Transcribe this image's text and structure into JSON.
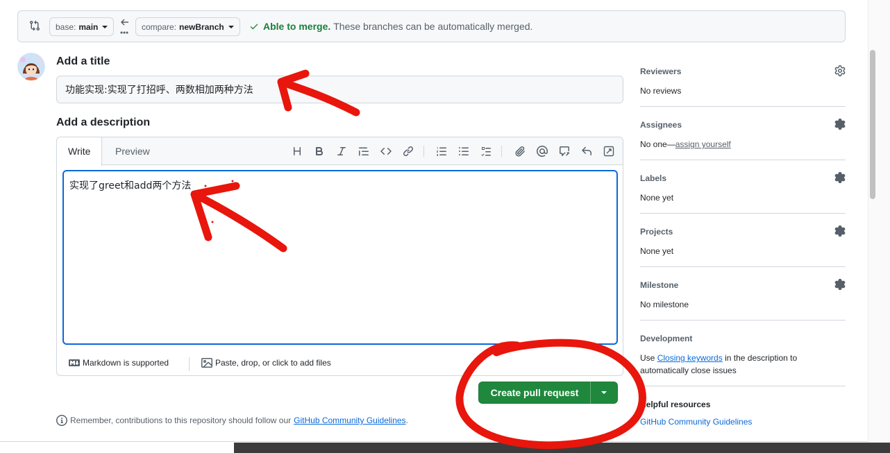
{
  "compare_bar": {
    "base_prefix": "base:",
    "base_branch": "main",
    "compare_prefix": "compare:",
    "compare_branch": "newBranch",
    "merge_status": "Able to merge.",
    "merge_message": "These branches can be automatically merged."
  },
  "form": {
    "title_label": "Add a title",
    "title_value": "功能实现:实现了打招呼、两数相加两种方法",
    "description_label": "Add a description",
    "tabs": [
      {
        "label": "Write"
      },
      {
        "label": "Preview"
      }
    ],
    "description_value": "实现了greet和add两个方法",
    "markdown_hint": "Markdown is supported",
    "attach_hint": "Paste, drop, or click to add files",
    "submit_label": "Create pull request",
    "guidelines_prefix": "Remember, contributions to this repository should follow our",
    "guidelines_link": "GitHub Community Guidelines",
    "guidelines_suffix": "."
  },
  "sidebar": {
    "reviewers": {
      "label": "Reviewers",
      "value": "No reviews"
    },
    "assignees": {
      "label": "Assignees",
      "value_prefix": "No one—",
      "value_link": "assign yourself"
    },
    "labels": {
      "label": "Labels",
      "value": "None yet"
    },
    "projects": {
      "label": "Projects",
      "value": "None yet"
    },
    "milestone": {
      "label": "Milestone",
      "value": "No milestone"
    },
    "development": {
      "label": "Development",
      "value_prefix": "Use",
      "value_link": "Closing keywords",
      "value_suffix": "in the description to automatically close issues"
    },
    "helpful": {
      "label": "Helpful resources",
      "link": "GitHub Community Guidelines"
    }
  },
  "colors": {
    "accent": "#0969da",
    "success": "#1a7f37",
    "primary_button": "#1f883d",
    "annotation": "#e8160c"
  }
}
